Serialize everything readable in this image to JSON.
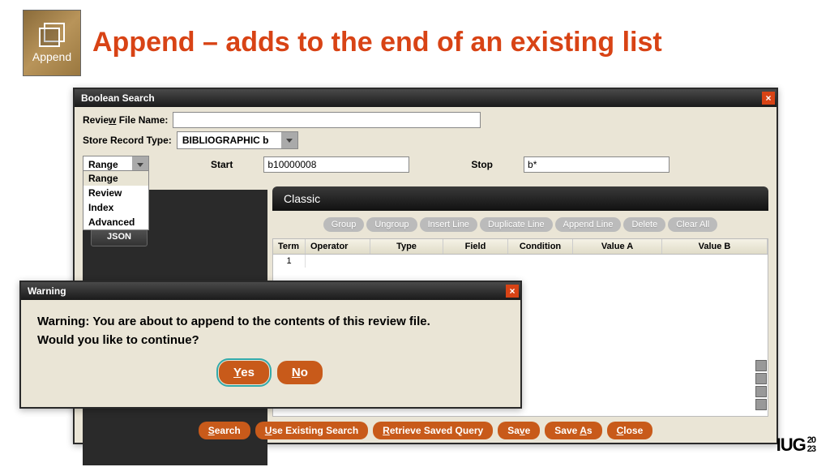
{
  "slide": {
    "title": "Append – adds to the end of an existing list",
    "badge_label": "Append"
  },
  "main": {
    "title": "Boolean Search",
    "review_label": "Review File Name:",
    "review_value": "",
    "store_label": "Store Record Type:",
    "store_value": "BIBLIOGRAPHIC b",
    "range": {
      "selected": "Range",
      "options": [
        "Range",
        "Review",
        "Index",
        "Advanced"
      ]
    },
    "start_label": "Start",
    "start_value": "b10000008",
    "stop_label": "Stop",
    "stop_value": "b*",
    "json_label": "JSON",
    "classic_label": "Classic",
    "toolbar": {
      "group": "Group",
      "ungroup": "Ungroup",
      "insert": "Insert Line",
      "duplicate": "Duplicate Line",
      "append": "Append Line",
      "delete": "Delete",
      "clear": "Clear All"
    },
    "columns": {
      "term": "Term",
      "operator": "Operator",
      "type": "Type",
      "field": "Field",
      "condition": "Condition",
      "valA": "Value A",
      "valB": "Value B"
    },
    "row1": "1",
    "actions": {
      "search": "Search",
      "use_existing": "Use Existing Search",
      "retrieve": "Retrieve Saved Query",
      "save": "Save",
      "save_as": "Save As",
      "close": "Close"
    }
  },
  "warning": {
    "title": "Warning",
    "line1": "Warning: You are about to append to the contents of this review file.",
    "line2": "Would you like to continue?",
    "yes": "Yes",
    "no": "No"
  },
  "footer": {
    "logo": "IUG",
    "y1": "20",
    "y2": "23"
  }
}
